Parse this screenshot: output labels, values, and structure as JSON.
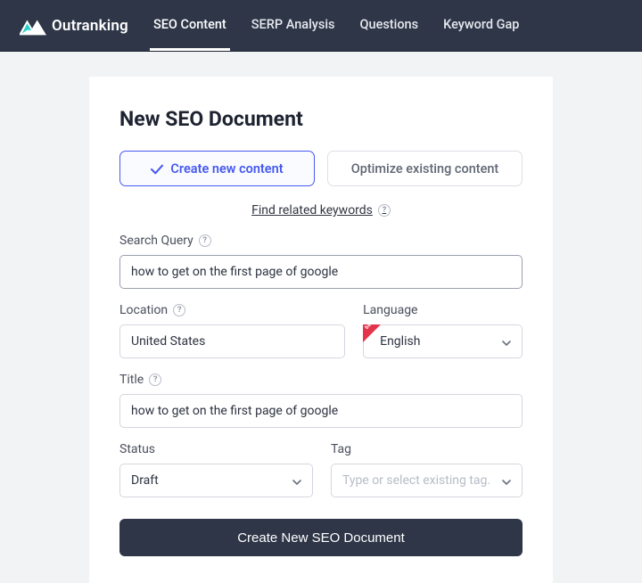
{
  "brand": {
    "name": "Outranking"
  },
  "nav": {
    "tabs": [
      {
        "label": "SEO Content",
        "active": true
      },
      {
        "label": "SERP Analysis",
        "active": false
      },
      {
        "label": "Questions",
        "active": false
      },
      {
        "label": "Keyword Gap",
        "active": false
      }
    ]
  },
  "page": {
    "title": "New SEO Document",
    "toggle": {
      "create_label": "Create new content",
      "optimize_label": "Optimize existing content"
    },
    "related_link": "Find related keywords",
    "fields": {
      "search_query": {
        "label": "Search Query",
        "value": "how to get on the first page of google"
      },
      "location": {
        "label": "Location",
        "value": "United States"
      },
      "language": {
        "label": "Language",
        "value": "English",
        "badge": "beta"
      },
      "title": {
        "label": "Title",
        "value": "how to get on the first page of google"
      },
      "status": {
        "label": "Status",
        "value": "Draft"
      },
      "tag": {
        "label": "Tag",
        "placeholder": "Type or select existing tag."
      }
    },
    "submit_label": "Create New SEO Document"
  }
}
